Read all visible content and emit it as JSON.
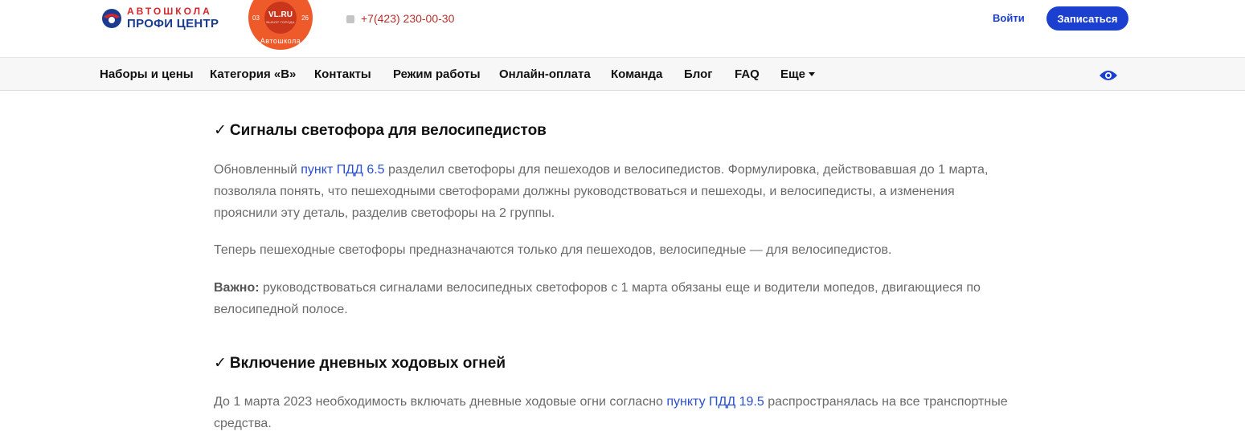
{
  "header": {
    "logo": {
      "small": "АВТОШКОЛА",
      "big": "ПРОФИ ЦЕНТР"
    },
    "badge": {
      "title": "VL.RU",
      "subtitle": "ВЫБОР ГОРОДА",
      "left_num": "03",
      "right_num": "26",
      "ring": "Автошкола"
    },
    "phone": "+7(423) 230-00-30",
    "login": "Войти",
    "signup": "Записаться"
  },
  "nav": {
    "items": [
      "Наборы и цены",
      "Категория «В»",
      "Контакты",
      "Режим работы",
      "Онлайн-оплата",
      "Команда",
      "Блог",
      "FAQ",
      "Еще"
    ]
  },
  "content": {
    "section1": {
      "check": "✓",
      "title": "Сигналы светофора для велосипедистов",
      "p1_before": "Обновленный ",
      "p1_link": "пункт ПДД 6.5",
      "p1_after": " разделил светофоры для пешеходов и велосипедистов. Формулировка, действовавшая до 1 марта, позволяла понять, что пешеходными светофорами должны руководствоваться и пешеходы, и велосипедисты, а изменения прояснили эту деталь, разделив светофоры на 2 группы.",
      "p2": "Теперь пешеходные светофоры предназначаются только для пешеходов, велосипедные — для велосипедистов.",
      "p3_bold": "Важно:",
      "p3_text": " руководствоваться сигналами велосипедных светофоров с 1 марта обязаны еще и водители мопедов, двигающиеся по велосипедной полосе."
    },
    "section2": {
      "check": "✓",
      "title": "Включение дневных ходовых огней",
      "p1_before": "До 1 марта 2023 необходимость включать дневные ходовые огни согласно ",
      "p1_link": "пункту ПДД 19.5",
      "p1_after": " распространялась на все транспортные средства."
    }
  },
  "colors": {
    "brand_blue": "#1b3fce",
    "brand_red": "#d6262b",
    "badge_orange": "#ef5a2a",
    "link": "#2a4fd0"
  }
}
